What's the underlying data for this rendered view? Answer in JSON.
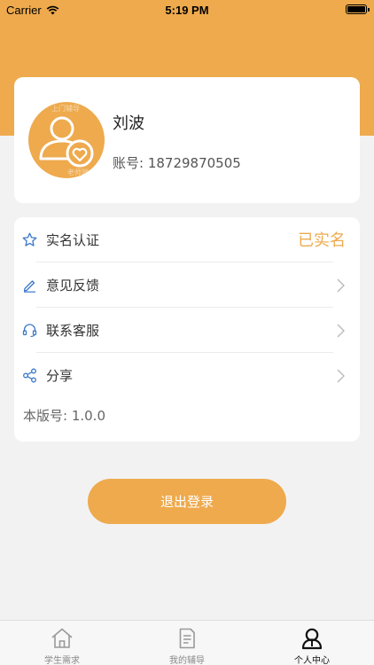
{
  "status_bar": {
    "carrier": "Carrier",
    "time": "5:19 PM"
  },
  "profile": {
    "name": "刘波",
    "account": "账号: 18729870505",
    "avatar_watermark_top": "上门辅导",
    "avatar_watermark_bottom": "老师端"
  },
  "menu": {
    "items": [
      {
        "label": "实名认证",
        "icon": "star-icon",
        "status": "已实名"
      },
      {
        "label": "意见反馈",
        "icon": "pencil-icon"
      },
      {
        "label": "联系客服",
        "icon": "headset-icon"
      },
      {
        "label": "分享",
        "icon": "share-icon"
      }
    ],
    "version": "本版号: 1.0.0"
  },
  "logout": {
    "label": "退出登录"
  },
  "tabs": [
    {
      "label": "学生需求",
      "icon": "home-icon",
      "active": false
    },
    {
      "label": "我的辅导",
      "icon": "document-icon",
      "active": false
    },
    {
      "label": "个人中心",
      "icon": "person-icon",
      "active": true
    }
  ],
  "colors": {
    "accent": "#eeaa4d",
    "icon_blue": "#3b78c9",
    "background": "#f2f2f2"
  }
}
